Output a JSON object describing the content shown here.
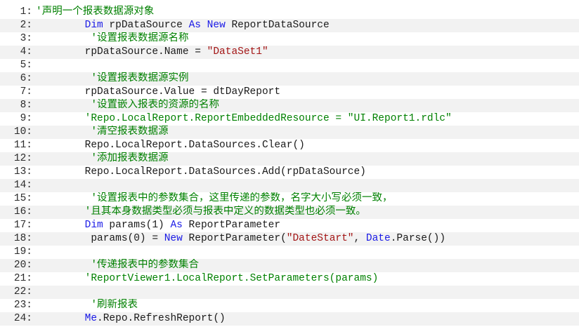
{
  "colors": {
    "keyword": "#1a1ae6",
    "comment": "#008000",
    "string": "#a31515",
    "text": "#1a1a1a",
    "alt_row": "#f2f2f2",
    "background": "#ffffff"
  },
  "code": {
    "lines": [
      {
        "number": "1:",
        "tokens": [
          {
            "t": "cmt",
            "text": "'声明一个报表数据源对象"
          }
        ]
      },
      {
        "number": "2:",
        "tokens": [
          {
            "t": "plain",
            "text": "        "
          },
          {
            "t": "kw",
            "text": "Dim"
          },
          {
            "t": "plain",
            "text": " rpDataSource "
          },
          {
            "t": "kw",
            "text": "As"
          },
          {
            "t": "plain",
            "text": " "
          },
          {
            "t": "kw",
            "text": "New"
          },
          {
            "t": "plain",
            "text": " ReportDataSource"
          }
        ]
      },
      {
        "number": "3:",
        "tokens": [
          {
            "t": "plain",
            "text": "         "
          },
          {
            "t": "cmt",
            "text": "'设置报表数据源名称"
          }
        ]
      },
      {
        "number": "4:",
        "tokens": [
          {
            "t": "plain",
            "text": "        rpDataSource.Name = "
          },
          {
            "t": "str",
            "text": "\"DataSet1\""
          }
        ]
      },
      {
        "number": "5:",
        "tokens": []
      },
      {
        "number": "6:",
        "tokens": [
          {
            "t": "plain",
            "text": "         "
          },
          {
            "t": "cmt",
            "text": "'设置报表数据源实例"
          }
        ]
      },
      {
        "number": "7:",
        "tokens": [
          {
            "t": "plain",
            "text": "        rpDataSource.Value = dtDayReport"
          }
        ]
      },
      {
        "number": "8:",
        "tokens": [
          {
            "t": "plain",
            "text": "         "
          },
          {
            "t": "cmt",
            "text": "'设置嵌入报表的资源的名称"
          }
        ]
      },
      {
        "number": "9:",
        "tokens": [
          {
            "t": "plain",
            "text": "        "
          },
          {
            "t": "cmt",
            "text": "'Repo.LocalReport.ReportEmbeddedResource = \"UI.Report1.rdlc\""
          }
        ]
      },
      {
        "number": "10:",
        "tokens": [
          {
            "t": "plain",
            "text": "         "
          },
          {
            "t": "cmt",
            "text": "'清空报表数据源"
          }
        ]
      },
      {
        "number": "11:",
        "tokens": [
          {
            "t": "plain",
            "text": "        Repo.LocalReport.DataSources.Clear()"
          }
        ]
      },
      {
        "number": "12:",
        "tokens": [
          {
            "t": "plain",
            "text": "         "
          },
          {
            "t": "cmt",
            "text": "'添加报表数据源"
          }
        ]
      },
      {
        "number": "13:",
        "tokens": [
          {
            "t": "plain",
            "text": "        Repo.LocalReport.DataSources.Add(rpDataSource)"
          }
        ]
      },
      {
        "number": "14:",
        "tokens": []
      },
      {
        "number": "15:",
        "tokens": [
          {
            "t": "plain",
            "text": "         "
          },
          {
            "t": "cmt",
            "text": "'设置报表中的参数集合，这里传递的参数，名字大小写必须一致，"
          }
        ]
      },
      {
        "number": "16:",
        "tokens": [
          {
            "t": "plain",
            "text": "        "
          },
          {
            "t": "cmt",
            "text": "'且其本身数据类型必须与报表中定义的数据类型也必须一致。"
          }
        ]
      },
      {
        "number": "17:",
        "tokens": [
          {
            "t": "plain",
            "text": "        "
          },
          {
            "t": "kw",
            "text": "Dim"
          },
          {
            "t": "plain",
            "text": " params(1) "
          },
          {
            "t": "kw",
            "text": "As"
          },
          {
            "t": "plain",
            "text": " ReportParameter"
          }
        ]
      },
      {
        "number": "18:",
        "tokens": [
          {
            "t": "plain",
            "text": "         params(0) = "
          },
          {
            "t": "kw",
            "text": "New"
          },
          {
            "t": "plain",
            "text": " ReportParameter("
          },
          {
            "t": "str",
            "text": "\"DateStart\""
          },
          {
            "t": "plain",
            "text": ", "
          },
          {
            "t": "kw",
            "text": "Date"
          },
          {
            "t": "plain",
            "text": ".Parse())"
          }
        ]
      },
      {
        "number": "19:",
        "tokens": []
      },
      {
        "number": "20:",
        "tokens": [
          {
            "t": "plain",
            "text": "         "
          },
          {
            "t": "cmt",
            "text": "'传递报表中的参数集合"
          }
        ]
      },
      {
        "number": "21:",
        "tokens": [
          {
            "t": "plain",
            "text": "        "
          },
          {
            "t": "cmt",
            "text": "'ReportViewer1.LocalReport.SetParameters(params)"
          }
        ]
      },
      {
        "number": "22:",
        "tokens": []
      },
      {
        "number": "23:",
        "tokens": [
          {
            "t": "plain",
            "text": "         "
          },
          {
            "t": "cmt",
            "text": "'刷新报表"
          }
        ]
      },
      {
        "number": "24:",
        "tokens": [
          {
            "t": "plain",
            "text": "        "
          },
          {
            "t": "kw",
            "text": "Me"
          },
          {
            "t": "plain",
            "text": ".Repo.RefreshReport()"
          }
        ]
      }
    ]
  }
}
